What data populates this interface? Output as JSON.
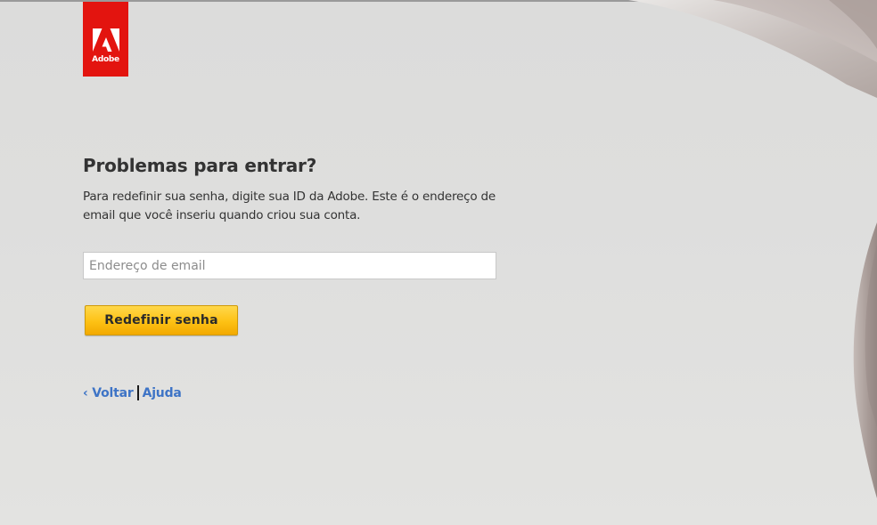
{
  "brand": {
    "name": "Adobe",
    "color": "#e3140f"
  },
  "page": {
    "title": "Problemas para entrar?",
    "description": "Para redefinir sua senha, digite sua ID da Adobe. Este é o endereço de email que você inseriu quando criou sua conta."
  },
  "form": {
    "email": {
      "placeholder": "Endereço de email",
      "value": ""
    },
    "submit_label": "Redefinir senha",
    "submit_color": "#fdc114"
  },
  "footer": {
    "back_label": "‹ Voltar",
    "help_label": "Ajuda",
    "link_color": "#3e74c6"
  }
}
